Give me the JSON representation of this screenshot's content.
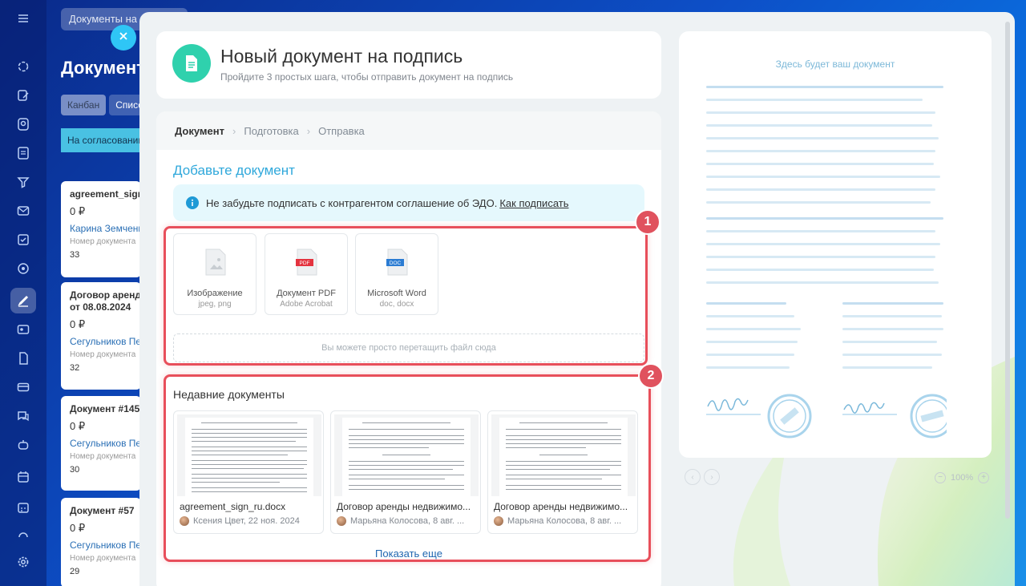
{
  "background": {
    "search_text": "Документы на",
    "page_title": "Документ",
    "tabs": [
      "Канбан",
      "Списо"
    ],
    "column_header": "На согласовании",
    "cards": [
      {
        "title": "agreement_sign_",
        "title2": "",
        "amount": "0 ₽",
        "person": "Карина Земченк",
        "label": "Номер документа",
        "number": "33"
      },
      {
        "title": "Договор аренды",
        "title2": "от 08.08.2024",
        "amount": "0 ₽",
        "person": "Сегульников Пе",
        "label": "Номер документа",
        "number": "32"
      },
      {
        "title": "Документ #145",
        "title2": "",
        "amount": "0 ₽",
        "person": "Сегульников Пе",
        "label": "Номер документа",
        "number": "30"
      },
      {
        "title": "Документ #57",
        "title2": "",
        "amount": "0 ₽",
        "person": "Сегульников Пе",
        "label": "Номер документа",
        "number": "29"
      }
    ]
  },
  "header": {
    "title": "Новый документ на подпись",
    "subtitle": "Пройдите 3 простых шага, чтобы отправить документ на подпись"
  },
  "steps": [
    "Документ",
    "Подготовка",
    "Отправка"
  ],
  "add_doc": {
    "title": "Добавьте документ",
    "info_text": "Не забудьте подписать с контрагентом соглашение об ЭДО.",
    "info_link": "Как подписать"
  },
  "file_types": [
    {
      "name": "Изображение",
      "ext": "jpeg, png",
      "icon": "image-file-icon"
    },
    {
      "name": "Документ PDF",
      "ext": "Adobe Acrobat",
      "icon": "pdf-file-icon",
      "badge": "PDF"
    },
    {
      "name": "Microsoft Word",
      "ext": "doc, docx",
      "icon": "word-file-icon",
      "badge": "DOC"
    }
  ],
  "dropzone_text": "Вы можете просто перетащить файл сюда",
  "recent": {
    "title": "Недавние документы",
    "items": [
      {
        "name": "agreement_sign_ru.docx",
        "author": "Ксения Цвет, 22 ноя. 2024"
      },
      {
        "name": "Договор аренды недвижимо...",
        "author": "Марьяна Колосова, 8 авг. ..."
      },
      {
        "name": "Договор аренды недвижимо...",
        "author": "Марьяна Колосова, 8 авг. ..."
      }
    ],
    "show_more": "Показать еще"
  },
  "annotations": [
    "1",
    "2"
  ],
  "preview": {
    "title": "Здесь будет ваш документ",
    "zoom": "100%"
  },
  "colors": {
    "accent_blue": "#2fa8db",
    "highlight_red": "#e84f5b",
    "doc_badge_green": "#2fd1ad"
  }
}
